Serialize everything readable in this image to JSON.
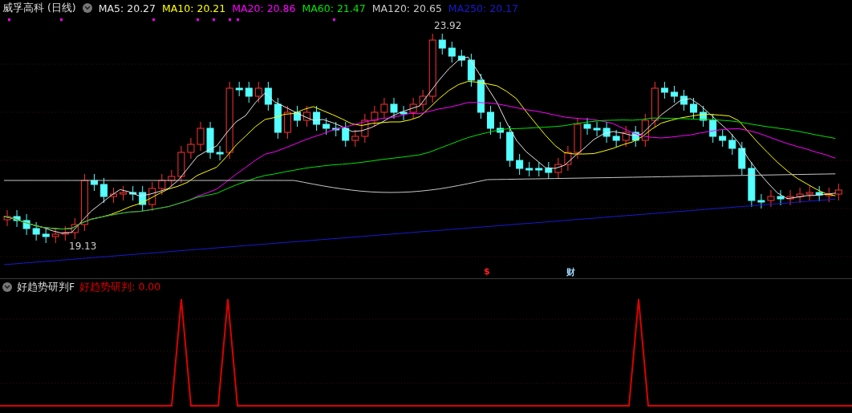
{
  "stock": {
    "name": "威孚高科",
    "period": "(日线)"
  },
  "moving_averages": [
    {
      "label": "MA5: 20.27",
      "color": "#e6e6e6"
    },
    {
      "label": "MA10: 20.21",
      "color": "#ffff00"
    },
    {
      "label": "MA20: 20.86",
      "color": "#ff00ff"
    },
    {
      "label": "MA60: 21.47",
      "color": "#00e600"
    },
    {
      "label": "MA120: 20.65",
      "color": "#c8c8c8"
    },
    {
      "label": "MA250: 20.17",
      "color": "#1a1ad2"
    }
  ],
  "price_chart": {
    "high_label": "23.92",
    "low_label": "19.13",
    "event_markers": [
      {
        "kind": "dividend",
        "text": "$"
      },
      {
        "kind": "finance",
        "text": "财"
      }
    ]
  },
  "indicator": {
    "name": "好趋势研判F",
    "reading": "好趋势研判: 0.00"
  }
}
